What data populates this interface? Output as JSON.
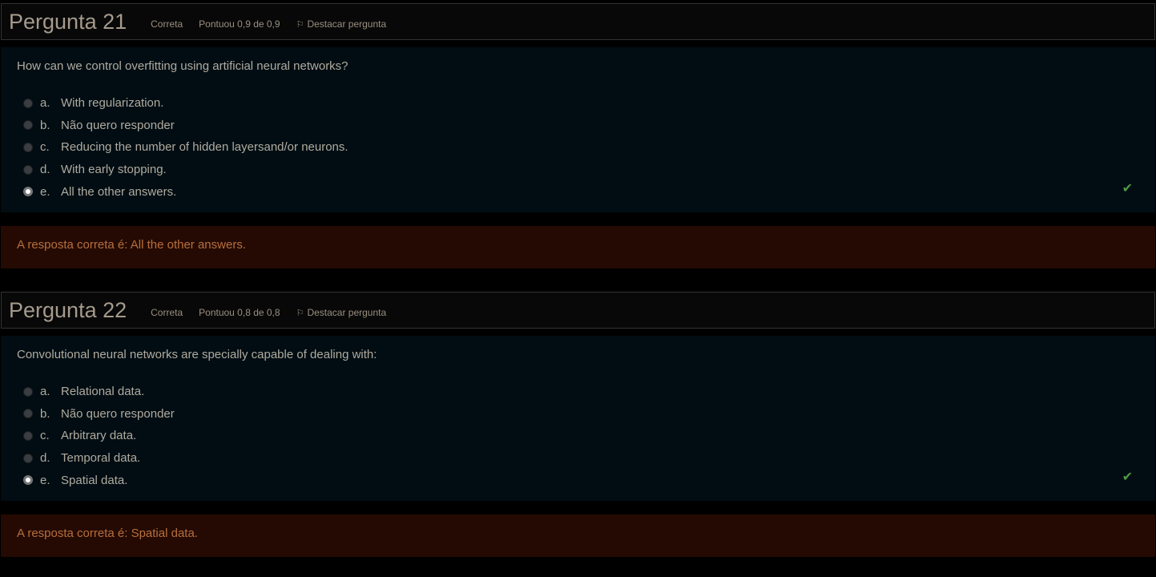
{
  "questions": [
    {
      "title": "Pergunta 21",
      "status": "Correta",
      "score": "Pontuou 0,9 de 0,9",
      "flag_label": "Destacar pergunta",
      "text": "How can we control overfitting using artificial neural networks?",
      "options": [
        {
          "letter": "a.",
          "text": "With regularization."
        },
        {
          "letter": "b.",
          "text": "Não quero responder"
        },
        {
          "letter": "c.",
          "text": "Reducing the number of hidden layersand/or neurons."
        },
        {
          "letter": "d.",
          "text": "With early stopping."
        },
        {
          "letter": "e.",
          "text": "All the other answers."
        }
      ],
      "selected": "e",
      "feedback": "A resposta correta é: All the other answers."
    },
    {
      "title": "Pergunta 22",
      "status": "Correta",
      "score": "Pontuou 0,8 de 0,8",
      "flag_label": "Destacar pergunta",
      "text": "Convolutional neural networks are specially capable of dealing with:",
      "options": [
        {
          "letter": "a.",
          "text": "Relational data."
        },
        {
          "letter": "b.",
          "text": "Não quero responder"
        },
        {
          "letter": "c.",
          "text": "Arbitrary data."
        },
        {
          "letter": "d.",
          "text": "Temporal data."
        },
        {
          "letter": "e.",
          "text": "Spatial data."
        }
      ],
      "selected": "e",
      "feedback": "A resposta correta é: Spatial data."
    }
  ],
  "colors": {
    "correct_check": "#4f9a45",
    "feedback_bg": "#250a03"
  }
}
